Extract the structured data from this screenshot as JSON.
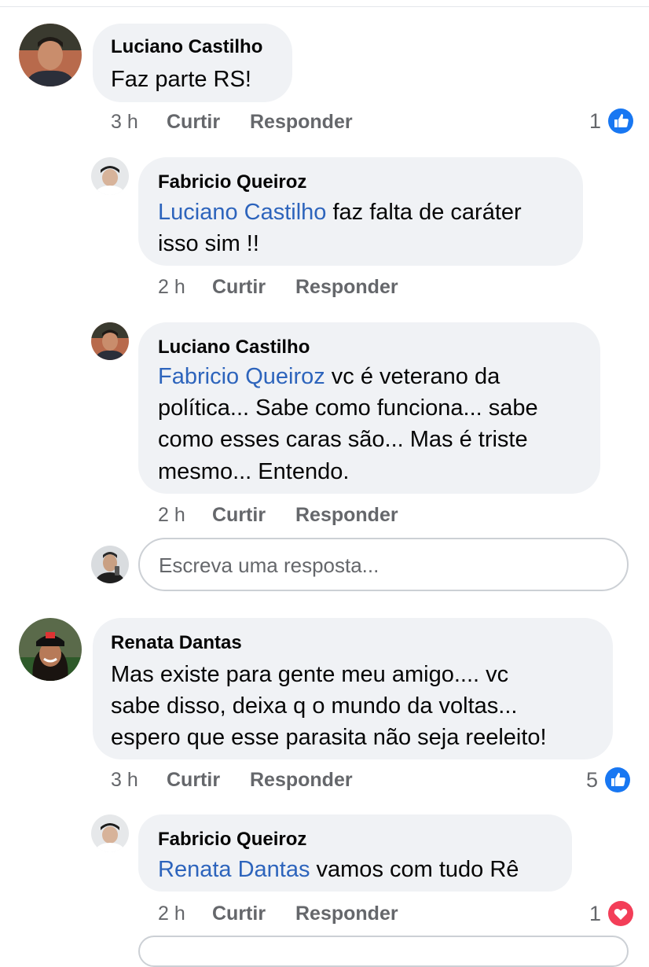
{
  "comments": [
    {
      "author": "Luciano Castilho",
      "text": "Faz parte RS!",
      "time": "3 h",
      "like_label": "Curtir",
      "reply_label": "Responder",
      "reactions": {
        "count": "1",
        "icon": "like-icon",
        "color": "#1877f2"
      },
      "replies": [
        {
          "author": "Fabricio Queiroz",
          "mention": "Luciano Castilho",
          "lines": [
            " faz falta de caráter",
            "isso sim !!"
          ],
          "time": "2 h",
          "like_label": "Curtir",
          "reply_label": "Responder"
        },
        {
          "author": "Luciano Castilho",
          "mention": "Fabricio Queiroz",
          "lines": [
            " vc é veterano da",
            "política... Sabe como funciona... sabe",
            "como esses caras são... Mas é triste",
            "mesmo... Entendo."
          ],
          "time": "2 h",
          "like_label": "Curtir",
          "reply_label": "Responder"
        }
      ],
      "reply_input": {
        "placeholder": "Escreva uma resposta..."
      }
    },
    {
      "author": "Renata Dantas",
      "lines": [
        "Mas existe para gente meu amigo.... vc",
        "sabe disso, deixa q o mundo da voltas...",
        "espero que esse parasita não seja reeleito!"
      ],
      "time": "3 h",
      "like_label": "Curtir",
      "reply_label": "Responder",
      "reactions": {
        "count": "5",
        "icon": "like-icon",
        "color": "#1877f2"
      },
      "replies": [
        {
          "author": "Fabricio Queiroz",
          "mention": "Renata Dantas",
          "lines": [
            " vamos com tudo Rê"
          ],
          "time": "2 h",
          "like_label": "Curtir",
          "reply_label": "Responder",
          "reactions": {
            "count": "1",
            "icon": "love-icon",
            "color": "#f33e58"
          }
        }
      ]
    }
  ],
  "colors": {
    "mention": "#2d64bc",
    "bubble": "#f0f2f5",
    "meta": "#65676b"
  }
}
